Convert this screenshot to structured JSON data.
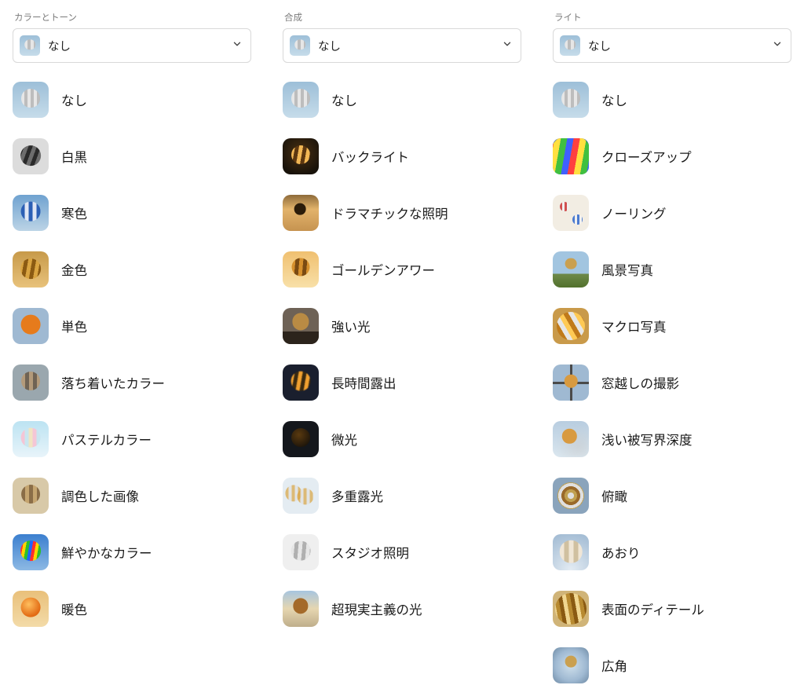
{
  "columns": [
    {
      "id": "color-tone",
      "title": "カラーとトーン",
      "selected": {
        "label": "なし",
        "thumb": "t-none"
      },
      "options": [
        {
          "label": "なし",
          "thumb": "t-none",
          "name": "option-none"
        },
        {
          "label": "白黒",
          "thumb": "t-bw",
          "name": "option-bw"
        },
        {
          "label": "寒色",
          "thumb": "t-cool",
          "name": "option-cool"
        },
        {
          "label": "金色",
          "thumb": "t-gold",
          "name": "option-gold"
        },
        {
          "label": "単色",
          "thumb": "t-mono",
          "name": "option-monochrome"
        },
        {
          "label": "落ち着いたカラー",
          "thumb": "t-muted",
          "name": "option-muted"
        },
        {
          "label": "パステルカラー",
          "thumb": "t-pastel",
          "name": "option-pastel"
        },
        {
          "label": "調色した画像",
          "thumb": "t-toned",
          "name": "option-toned"
        },
        {
          "label": "鮮やかなカラー",
          "thumb": "t-vibrant",
          "name": "option-vibrant"
        },
        {
          "label": "暖色",
          "thumb": "t-warm",
          "name": "option-warm"
        }
      ]
    },
    {
      "id": "composition",
      "title": "合成",
      "selected": {
        "label": "なし",
        "thumb": "t-none"
      },
      "options": [
        {
          "label": "なし",
          "thumb": "t-none",
          "name": "option-none"
        },
        {
          "label": "バックライト",
          "thumb": "t-backlight",
          "name": "option-backlight"
        },
        {
          "label": "ドラマチックな照明",
          "thumb": "t-dramatic",
          "name": "option-dramatic-lighting"
        },
        {
          "label": "ゴールデンアワー",
          "thumb": "t-goldenhour",
          "name": "option-golden-hour"
        },
        {
          "label": "強い光",
          "thumb": "t-hard",
          "name": "option-hard-light"
        },
        {
          "label": "長時間露出",
          "thumb": "t-longexp",
          "name": "option-long-exposure"
        },
        {
          "label": "微光",
          "thumb": "t-lowlight",
          "name": "option-low-light"
        },
        {
          "label": "多重露光",
          "thumb": "t-multiexp",
          "name": "option-multi-exposure"
        },
        {
          "label": "スタジオ照明",
          "thumb": "t-studio",
          "name": "option-studio-lighting"
        },
        {
          "label": "超現実主義の光",
          "thumb": "t-surreal",
          "name": "option-surreal-light"
        }
      ]
    },
    {
      "id": "light",
      "title": "ライト",
      "selected": {
        "label": "なし",
        "thumb": "t-none"
      },
      "options": [
        {
          "label": "なし",
          "thumb": "t-none",
          "name": "option-none"
        },
        {
          "label": "クローズアップ",
          "thumb": "t-closeup",
          "name": "option-closeup"
        },
        {
          "label": "ノーリング",
          "thumb": "t-knolling",
          "name": "option-knolling"
        },
        {
          "label": "風景写真",
          "thumb": "t-landscape",
          "name": "option-landscape"
        },
        {
          "label": "マクロ写真",
          "thumb": "t-macro",
          "name": "option-macro"
        },
        {
          "label": "窓越しの撮影",
          "thumb": "t-window",
          "name": "option-through-window"
        },
        {
          "label": "浅い被写界深度",
          "thumb": "t-shallow",
          "name": "option-shallow-dof"
        },
        {
          "label": "俯瞰",
          "thumb": "t-topdown",
          "name": "option-top-down"
        },
        {
          "label": "あおり",
          "thumb": "t-lookup",
          "name": "option-looking-up"
        },
        {
          "label": "表面のディテール",
          "thumb": "t-surface",
          "name": "option-surface-detail"
        },
        {
          "label": "広角",
          "thumb": "t-wide",
          "name": "option-wide-angle"
        }
      ]
    }
  ]
}
